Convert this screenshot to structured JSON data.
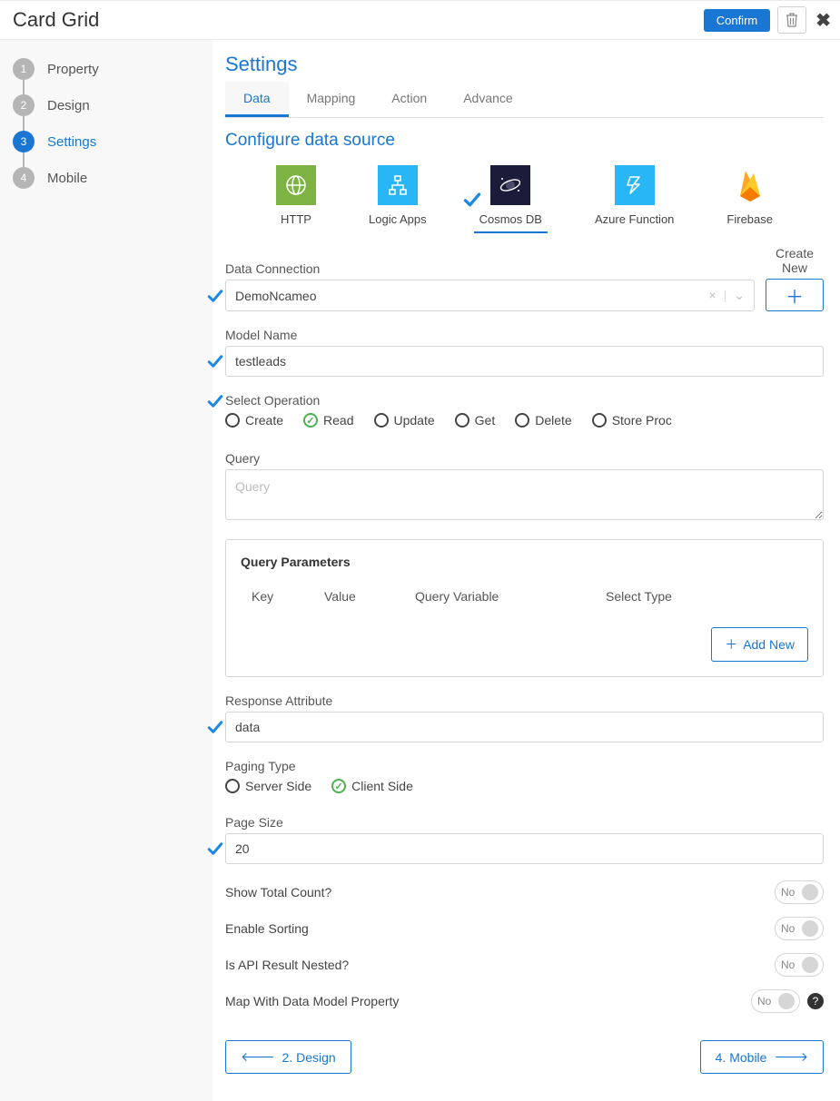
{
  "header": {
    "title": "Card Grid",
    "confirm": "Confirm"
  },
  "steps": [
    {
      "n": "1",
      "label": "Property"
    },
    {
      "n": "2",
      "label": "Design"
    },
    {
      "n": "3",
      "label": "Settings",
      "active": true
    },
    {
      "n": "4",
      "label": "Mobile"
    }
  ],
  "settings": {
    "title": "Settings",
    "tabs": {
      "data": "Data",
      "mapping": "Mapping",
      "action": "Action",
      "advance": "Advance",
      "active": "data"
    },
    "subtitle": "Configure data source",
    "sources": {
      "http": "HTTP",
      "logicapps": "Logic Apps",
      "cosmos": "Cosmos DB",
      "azurefn": "Azure Function",
      "firebase": "Firebase",
      "selected": "cosmos"
    },
    "dataConnection": {
      "label": "Data Connection",
      "value": "DemoNcameo",
      "createNew": "Create New"
    },
    "modelName": {
      "label": "Model Name",
      "value": "testleads"
    },
    "selectOperation": {
      "label": "Select Operation",
      "options": {
        "create": "Create",
        "read": "Read",
        "update": "Update",
        "get": "Get",
        "delete": "Delete",
        "storeproc": "Store Proc"
      },
      "selected": "read"
    },
    "query": {
      "label": "Query",
      "placeholder": "Query",
      "value": ""
    },
    "queryParams": {
      "title": "Query Parameters",
      "headers": {
        "key": "Key",
        "value": "Value",
        "queryVariable": "Query Variable",
        "selectType": "Select Type"
      },
      "addNew": "Add New"
    },
    "responseAttribute": {
      "label": "Response Attribute",
      "value": "data"
    },
    "pagingType": {
      "label": "Paging Type",
      "server": "Server Side",
      "client": "Client Side",
      "selected": "client"
    },
    "pageSize": {
      "label": "Page Size",
      "value": "20"
    },
    "toggles": {
      "showTotal": {
        "label": "Show Total Count?",
        "value": "No"
      },
      "enableSorting": {
        "label": "Enable Sorting",
        "value": "No"
      },
      "apiNested": {
        "label": "Is API Result Nested?",
        "value": "No"
      },
      "mapModel": {
        "label": "Map With Data Model Property",
        "value": "No"
      }
    },
    "nav": {
      "prev": "2. Design",
      "next": "4. Mobile"
    }
  }
}
